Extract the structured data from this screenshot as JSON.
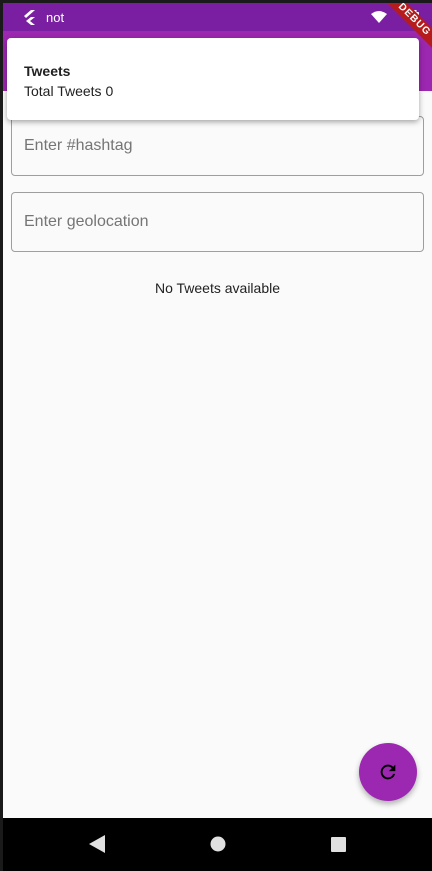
{
  "status_bar": {
    "notification_text": "not",
    "debug_label": "DEBUG"
  },
  "notification": {
    "title": "Tweets",
    "body": "Total Tweets 0"
  },
  "form": {
    "hashtag_placeholder": "Enter #hashtag",
    "geolocation_placeholder": "Enter geolocation"
  },
  "content": {
    "empty_message": "No Tweets available"
  },
  "fab": {
    "icon": "refresh-icon"
  },
  "navigation": {
    "buttons": [
      "back-icon",
      "home-icon",
      "recents-icon"
    ]
  },
  "colors": {
    "status_bar": "#7b1fa2",
    "primary": "#9c27b0",
    "background": "#fafafa"
  }
}
